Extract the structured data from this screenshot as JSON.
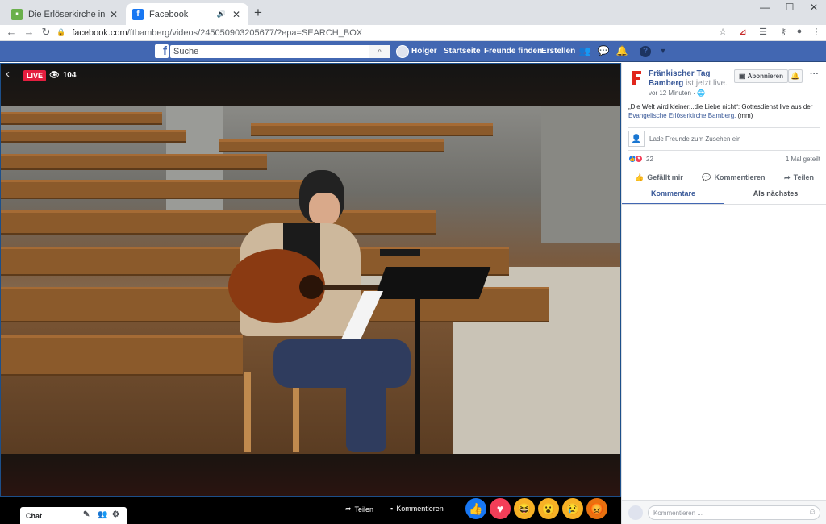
{
  "browser": {
    "tabs": [
      {
        "title": "Die Erlöserkirche in Bamberg ist j",
        "close": "✕"
      },
      {
        "title": "Facebook",
        "close": "✕"
      }
    ],
    "new_tab": "+",
    "window_controls": [
      "—",
      "☐",
      "✕"
    ],
    "url_host": "facebook.com",
    "url_path": "/ftbamberg/videos/245050903205677/?epa=SEARCH_BOX"
  },
  "fb_header": {
    "logo": "f",
    "search_placeholder": "Suche",
    "user": "Holger",
    "nav": [
      "Startseite",
      "Freunde finden",
      "Erstellen"
    ]
  },
  "video": {
    "live_label": "LIVE",
    "viewers": "104"
  },
  "bottom_bar": {
    "share": "Teilen",
    "comment": "Kommentieren",
    "reactions": [
      "like-reaction",
      "love-reaction",
      "haha-reaction",
      "wow-reaction",
      "sad-reaction",
      "angry-reaction"
    ],
    "chat": "Chat"
  },
  "panel": {
    "page_name": "Fränkischer Tag Bamberg",
    "live_suffix": "ist jetzt live.",
    "time": "vor 12 Minuten ·",
    "subscribe": "Abonnieren",
    "description": "„Die Welt wird kleiner...die Liebe nicht“: Gottesdienst live aus der",
    "description_link": "Evangelische Erlöserkirche Bamberg.",
    "description_suffix": "(mm)",
    "invite": "Lade Freunde zum Zusehen ein",
    "reaction_count": "22",
    "shares": "1 Mal geteilt",
    "actions": [
      "Gefällt mir",
      "Kommentieren",
      "Teilen"
    ],
    "tabs": [
      "Kommentare",
      "Als nächstes"
    ],
    "comment_placeholder": "Kommentieren ..."
  },
  "colors": {
    "fb_blue": "#4267b2",
    "live_red": "#e41e3f",
    "link_blue": "#385898"
  }
}
